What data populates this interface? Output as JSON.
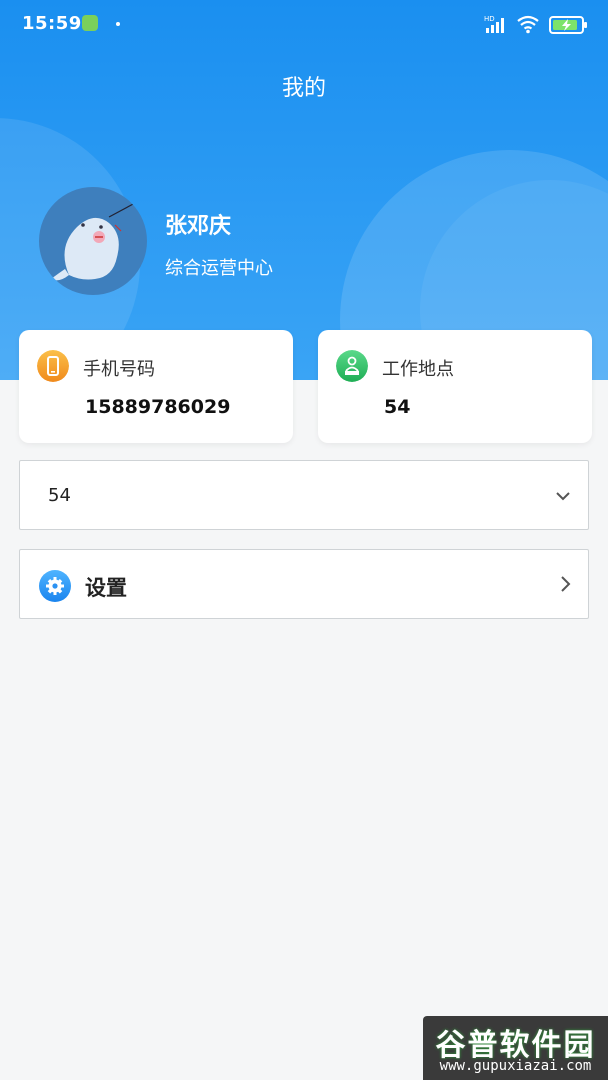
{
  "status_bar": {
    "time": "15:59",
    "network": "HD"
  },
  "header": {
    "title": "我的"
  },
  "profile": {
    "name": "张邓庆",
    "department": "综合运营中心"
  },
  "info_cards": [
    {
      "label": "手机号码",
      "value": "15889786029",
      "icon": "phone-icon",
      "icon_color": "#f4a020"
    },
    {
      "label": "工作地点",
      "value": "54",
      "icon": "location-person-icon",
      "icon_color": "#2ec46a"
    }
  ],
  "selector": {
    "value": "54"
  },
  "menu": {
    "settings_label": "设置"
  },
  "watermark": {
    "brand": "谷普软件园",
    "url": "www.gupuxiazai.com"
  },
  "colors": {
    "primary": "#1a8ff0",
    "background": "#f5f6f7"
  }
}
